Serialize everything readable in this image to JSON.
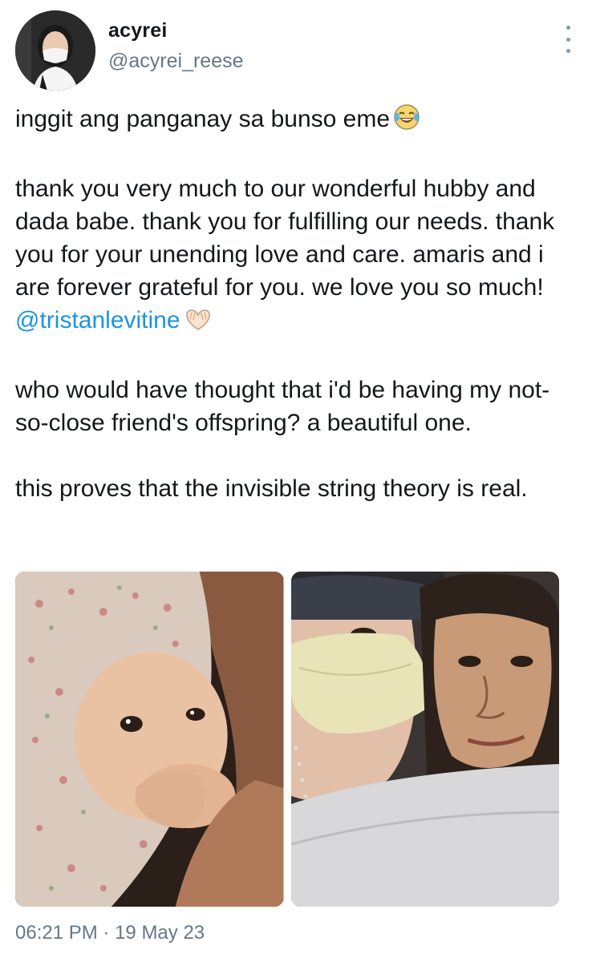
{
  "author": {
    "display_name": "acyrei",
    "handle": "@acyrei_reese",
    "avatar_icon": "profile-photo"
  },
  "menu": {
    "icon": "more-vertical-icon"
  },
  "text": {
    "p1": "inggit ang panganay sa bunso eme",
    "p1_emoji": "face-with-tears-of-joy",
    "p2": "thank you very much to our wonderful hubby and dada babe. thank you for fulfilling our needs. thank you for your unending love and care. amaris and i are forever grateful for you. we love you so much!",
    "mention": "@tristanlevitine",
    "p2_emoji": "heart-hands",
    "p3": "who would have thought that i'd be having my not-so-close friend's offspring? a beautiful one.",
    "p4": "this proves that the invisible string theory is real."
  },
  "media": [
    {
      "icon": "baby-photo"
    },
    {
      "icon": "couple-selfie-photo"
    }
  ],
  "meta": {
    "time": "06:21 PM",
    "separator": "·",
    "date": "19 May 23"
  },
  "colors": {
    "link": "#1b95e0",
    "secondary": "#657786",
    "text": "#14171a"
  }
}
